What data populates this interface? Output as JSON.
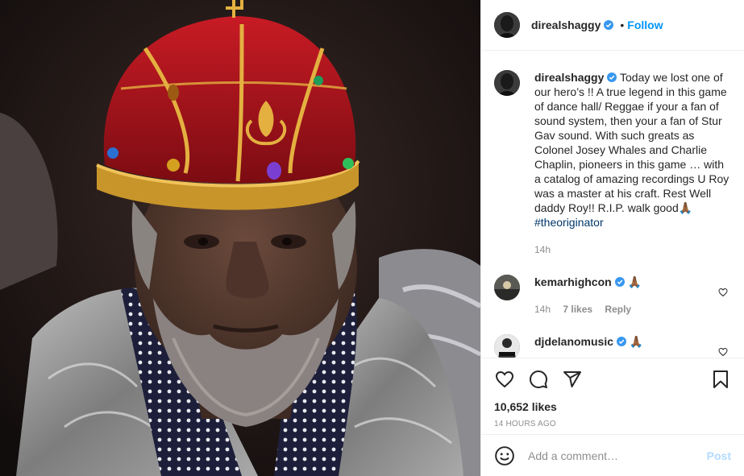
{
  "header": {
    "username": "direalshaggy",
    "separator": "•",
    "follow_label": "Follow"
  },
  "caption": {
    "username": "direalshaggy",
    "text": "Today we lost one of our hero’s !! A true legend in this game of dance hall/ Reggae if your a fan of sound system, then your a fan of Stur Gav sound. With such greats as Colonel Josey Whales and Charlie Chaplin, pioneers in this game … with a catalog of amazing recordings U Roy was a master at his craft. Rest Well daddy Roy!! R.I.P. walk good",
    "emoji": "🙏🏾",
    "hashtag": "#theoriginator",
    "age": "14h"
  },
  "comments": [
    {
      "username": "kemarhighcon",
      "text": "🙏🏾",
      "age": "14h",
      "likes": "7 likes",
      "reply": "Reply"
    },
    {
      "username": "djdelanomusic",
      "text": "🙏🏾"
    }
  ],
  "footer": {
    "likes": "10,652 likes",
    "timestamp": "14 HOURS AGO",
    "comment_placeholder": "Add a comment…",
    "post_label": "Post"
  },
  "colors": {
    "accent": "#0095f6",
    "hashtag": "#00376b",
    "muted": "#8e8e8e",
    "post_disabled": "#b3dbff"
  },
  "icons": [
    "heart-icon",
    "comment-icon",
    "share-icon",
    "bookmark-icon",
    "emoji-icon",
    "verified-badge-icon"
  ]
}
